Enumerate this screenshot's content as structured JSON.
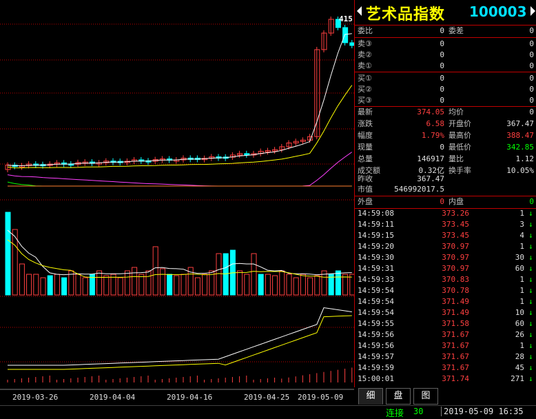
{
  "window": {
    "title": "艺术品指数",
    "code": "100003"
  },
  "chart": {
    "high_label": "415.41",
    "dates": [
      "2019-03-26",
      "2019-04-04",
      "2019-04-16",
      "2019-04-25",
      "2019-05-09"
    ]
  },
  "quote": {
    "weibi_label": "委比",
    "weibi_value": "0",
    "weicha_label": "委差",
    "weicha_value": "0",
    "sells": [
      {
        "label": "卖③",
        "price": "0",
        "vol": "0"
      },
      {
        "label": "卖②",
        "price": "0",
        "vol": "0"
      },
      {
        "label": "卖①",
        "price": "0",
        "vol": "0"
      }
    ],
    "buys": [
      {
        "label": "买①",
        "price": "0",
        "vol": "0"
      },
      {
        "label": "买②",
        "price": "0",
        "vol": "0"
      },
      {
        "label": "买③",
        "price": "0",
        "vol": "0"
      }
    ],
    "stats": {
      "latest_label": "最新",
      "latest": "374.05",
      "avg_label": "均价",
      "avg": "0",
      "change_label": "涨跌",
      "change": "6.58",
      "open_label": "开盘价",
      "open": "367.47",
      "amp_label": "幅度",
      "amp": "1.79%",
      "high_label": "最高价",
      "high": "388.47",
      "cur_label": "现量",
      "cur": "0",
      "low_label": "最低价",
      "low": "342.85",
      "total_label": "总量",
      "total": "146917",
      "ratio_label": "量比",
      "ratio": "1.12",
      "turnover_label": "成交额",
      "turnover": "0.32亿",
      "rate_label": "换手率",
      "rate": "10.05%",
      "prev_label": "昨收",
      "prev": "367.47",
      "mcap_label": "市值",
      "mcap": "546992017.5"
    },
    "outer_label": "外盘",
    "outer": "0",
    "inner_label": "内盘",
    "inner": "0"
  },
  "ticks": [
    {
      "time": "14:59:08",
      "price": "373.26",
      "vol": "1"
    },
    {
      "time": "14:59:11",
      "price": "373.45",
      "vol": "3"
    },
    {
      "time": "14:59:15",
      "price": "373.45",
      "vol": "4"
    },
    {
      "time": "14:59:20",
      "price": "370.97",
      "vol": "1"
    },
    {
      "time": "14:59:30",
      "price": "370.97",
      "vol": "30"
    },
    {
      "time": "14:59:31",
      "price": "370.97",
      "vol": "60"
    },
    {
      "time": "14:59:33",
      "price": "370.83",
      "vol": "1"
    },
    {
      "time": "14:59:54",
      "price": "370.78",
      "vol": "1"
    },
    {
      "time": "14:59:54",
      "price": "371.49",
      "vol": "1"
    },
    {
      "time": "14:59:54",
      "price": "371.49",
      "vol": "10"
    },
    {
      "time": "14:59:55",
      "price": "371.58",
      "vol": "60"
    },
    {
      "time": "14:59:56",
      "price": "371.67",
      "vol": "26"
    },
    {
      "time": "14:59:56",
      "price": "371.67",
      "vol": "1"
    },
    {
      "time": "14:59:57",
      "price": "371.67",
      "vol": "28"
    },
    {
      "time": "14:59:59",
      "price": "371.67",
      "vol": "45"
    },
    {
      "time": "15:00:01",
      "price": "371.74",
      "vol": "271"
    }
  ],
  "tabs": [
    "细",
    "盘",
    "图"
  ],
  "status": {
    "conn": "连接",
    "count": "30",
    "datetime": "2019-05-09 16:35"
  },
  "colors": {
    "up": "#ff4040",
    "down": "#00ffff",
    "grid": "#c00000",
    "ma5": "#ffffff",
    "ma10": "#ffff00",
    "ma20": "#ff40ff",
    "ma30": "#00ff00",
    "ma60": "#ff8030"
  }
}
